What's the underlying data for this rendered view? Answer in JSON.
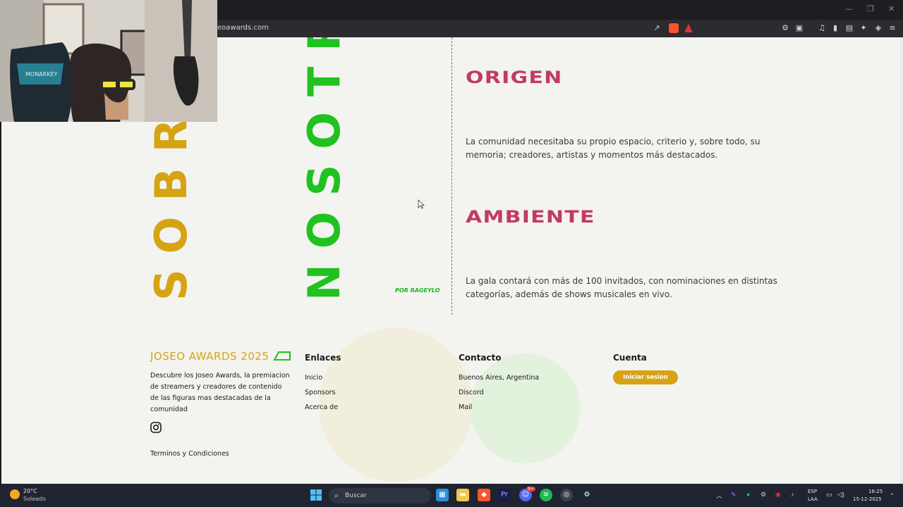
{
  "browser": {
    "url": "eoawards.com",
    "window_controls": [
      "—",
      "❐",
      "✕"
    ]
  },
  "page": {
    "vertical_left": "SOBRE",
    "vertical_right": "NOSOTROS",
    "por": "POR RAGEYLO",
    "origen": {
      "title": "ORIGEN",
      "text": "La comunidad necesitaba su propio espacio, criterio y, sobre todo, su memoria; creadores, artistas y momentos más destacados."
    },
    "ambiente": {
      "title": "AMBIENTE",
      "text": "La gala contará con más de 100 invitados, con nominaciones en distintas categorías, además de shows musicales en vivo."
    }
  },
  "footer": {
    "brand": "JOSEO AWARDS 2025",
    "description": "Descubre los Joseo Awards, la premiacion de streamers y creadores de contenido de las figuras mas destacadas de la comunidad",
    "terms": "Terminos y Condiciones",
    "enlaces": {
      "title": "Enlaces",
      "items": [
        "Inicio",
        "Sponsors",
        "Acerca de"
      ]
    },
    "contacto": {
      "title": "Contacto",
      "items": [
        "Buenos Aires, Argentina",
        "Discord",
        "Mail"
      ]
    },
    "cuenta": {
      "title": "Cuenta",
      "login": "Iniciar sesion"
    },
    "colors": {
      "gold": "#d6a313",
      "green": "#1fc21f",
      "pink": "#c23a63"
    }
  },
  "taskbar": {
    "weather_temp": "20°C",
    "weather_desc": "Soleado",
    "search_placeholder": "Buscar",
    "lang_top": "ESP",
    "lang_bottom": "LAA",
    "time": "16:25",
    "date": "15-12-2025",
    "discord_badge": "9+"
  },
  "webcam": {
    "chair_brand": "MONARKEY"
  }
}
